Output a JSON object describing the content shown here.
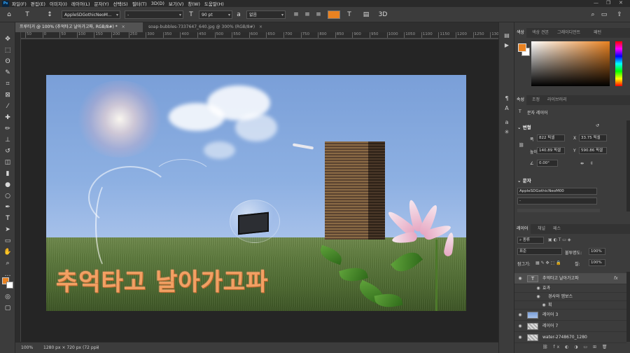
{
  "app": {
    "logo": "Ps"
  },
  "menu": [
    "파일(F)",
    "편집(E)",
    "이미지(I)",
    "레이어(L)",
    "문자(Y)",
    "선택(S)",
    "필터(T)",
    "3D(D)",
    "보기(V)",
    "창(W)",
    "도움말(H)"
  ],
  "options": {
    "font_family": "AppleSDGothicNeoM...",
    "font_style": "-",
    "font_size": "90 pt",
    "antialias": "없음",
    "text_color": "#e98221"
  },
  "tabs": [
    {
      "label": "프루티거 @ 100% (추억타고 날아가고파, RGB/8#) *",
      "close": "×"
    },
    {
      "label": "soap-bubbles-7337647_640.jpg @ 300% (RGB/8#)",
      "close": "×"
    }
  ],
  "ruler_ticks": [
    "50",
    "0",
    "50",
    "100",
    "150",
    "200",
    "250",
    "300",
    "350",
    "400",
    "450",
    "500",
    "550",
    "600",
    "650",
    "700",
    "750",
    "800",
    "850",
    "900",
    "950",
    "1000",
    "1050",
    "1100",
    "1150",
    "1200",
    "1250",
    "1300"
  ],
  "canvas": {
    "text": "추억타고 날아가고파"
  },
  "status": {
    "zoom": "100%",
    "doc_size": "1280 px × 720 px (72 ppi)"
  },
  "color_panel": {
    "tabs": [
      "색상",
      "색상 견본",
      "그레이디언트",
      "패턴"
    ],
    "foreground": "#e98221",
    "background": "#ffffff"
  },
  "properties_panel": {
    "tabs": [
      "속성",
      "조정",
      "라이브러리"
    ],
    "layer_type": "문자 레이어",
    "transform_header": "변형",
    "w_label": "폭",
    "w_value": "822 픽셀",
    "x_label": "X",
    "x_value": "33.75 픽셀",
    "h_label": "높이",
    "h_value": "140.89 픽셀",
    "y_label": "Y",
    "y_value": "590.86 픽셀",
    "angle": "0.00°",
    "type_header": "문자",
    "font": "AppleSDGothicNeoM00",
    "font_style": "-"
  },
  "layers_panel": {
    "tabs": [
      "레이어",
      "채널",
      "패스"
    ],
    "filter_kind": "종류",
    "blend_mode": "표준",
    "opacity_label": "불투명도:",
    "opacity_value": "100%",
    "lock_label": "잠그기:",
    "fill_label": "칠:",
    "fill_value": "100%",
    "layers": [
      {
        "name": "추억타고 날아가고파",
        "kind": "text",
        "selected": true,
        "fx": "fx"
      },
      {
        "name": "효과",
        "kind": "effects-group"
      },
      {
        "name": "경사와 엠보스",
        "kind": "effect"
      },
      {
        "name": "획",
        "kind": "effect"
      },
      {
        "name": "레이어 3",
        "kind": "pixel"
      },
      {
        "name": "레이어 7",
        "kind": "pixel"
      },
      {
        "name": "water-2748670_1280",
        "kind": "pixel"
      }
    ]
  }
}
